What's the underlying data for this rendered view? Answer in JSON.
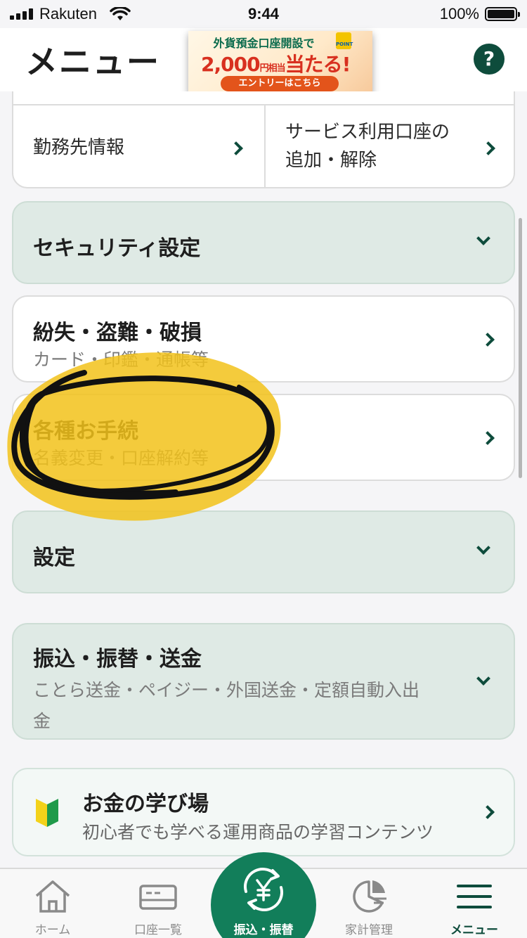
{
  "status_bar": {
    "carrier": "Rakuten",
    "time": "9:44",
    "battery": "100%"
  },
  "header": {
    "title": "メニュー",
    "help": "?",
    "ad": {
      "line1": "外貨預金口座開設で",
      "amount": "2,000",
      "amount_suffix": "円",
      "small_note": "相当",
      "line2_tail": "当たる!",
      "cta": "エントリーはこちら",
      "point_logo": "POINT"
    }
  },
  "partial_row": {
    "left_label": "勤務先情報",
    "right_label_line1": "サービス利用口座の",
    "right_label_line2": "追加・解除"
  },
  "security": {
    "title": "セキュリティ設定"
  },
  "loss": {
    "title": "紛失・盗難・破損",
    "sub": "カード・印鑑・通帳等"
  },
  "procedures": {
    "title": "各種お手続",
    "sub": "名義変更・口座解約等"
  },
  "settings": {
    "title": "設定"
  },
  "transfer": {
    "title": "振込・振替・送金",
    "sub_line1": "ことら送金・ペイジー・外国送金・定額自動入出",
    "sub_line2": "金"
  },
  "learning": {
    "title": "お金の学び場",
    "sub": "初心者でも学べる運用商品の学習コンテンツ"
  },
  "tab_bar": {
    "tabs": [
      {
        "label": "ホーム",
        "icon": "home-icon"
      },
      {
        "label": "口座一覧",
        "icon": "card-icon"
      },
      {
        "label": "振込・振替",
        "icon": "yen-transfer-icon"
      },
      {
        "label": "家計管理",
        "icon": "pie-chart-icon"
      },
      {
        "label": "メニュー",
        "icon": "menu-icon"
      }
    ],
    "active": "メニュー"
  },
  "colors": {
    "brand_green": "#0e4c3c",
    "accent_green": "#127e5a",
    "section_bg": "#dfeae5",
    "highlight_yellow": "#f2c21a"
  }
}
